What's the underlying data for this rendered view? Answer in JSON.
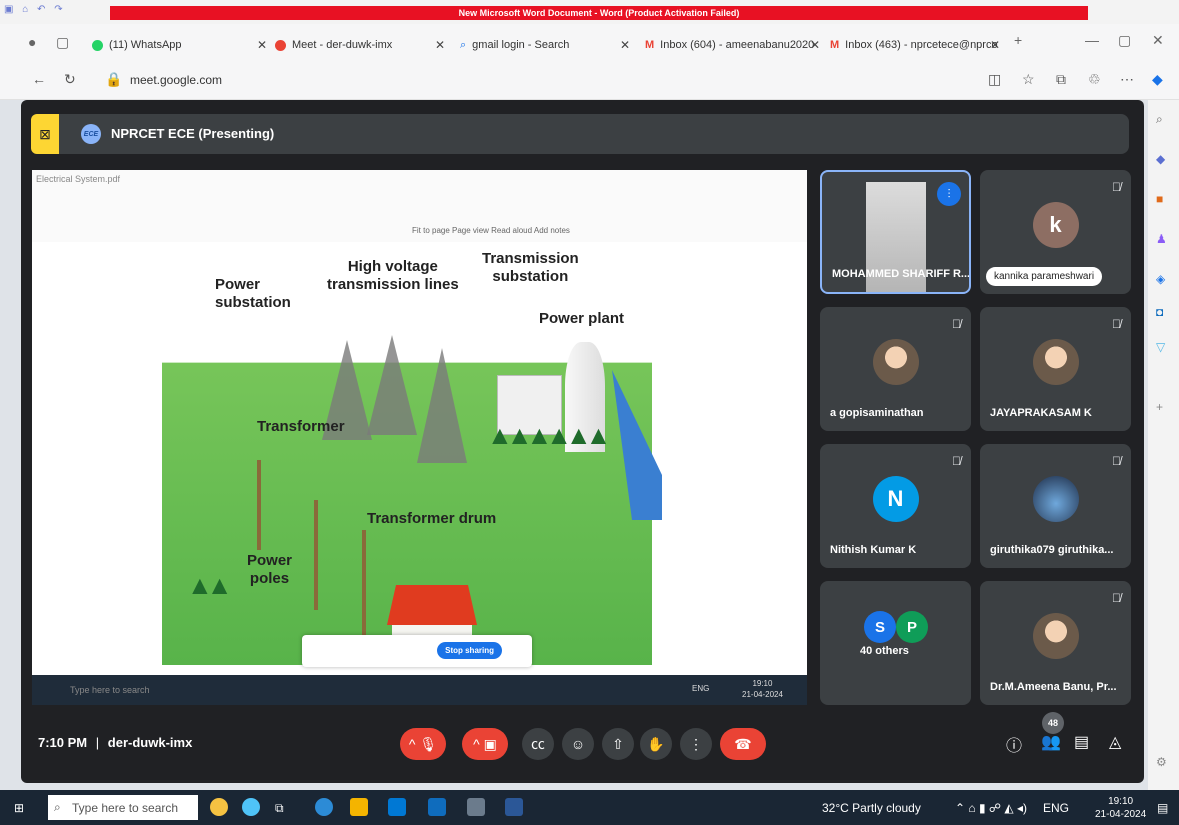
{
  "word": {
    "title": "New Microsoft Word Document - Word (Product Activation Failed)"
  },
  "browser": {
    "tabs": [
      {
        "label": "(11) WhatsApp"
      },
      {
        "label": "Meet - der-duwk-imx"
      },
      {
        "label": "gmail login - Search"
      },
      {
        "label": "Inbox (604) - ameenabanu2020"
      },
      {
        "label": "Inbox (463) - nprcetece@nprco"
      }
    ],
    "url_host": "meet.google.com"
  },
  "meet": {
    "presenter_logo": "ECE",
    "presenter_text": "NPRCET ECE (Presenting)",
    "time": "7:10 PM",
    "separator": "|",
    "code": "der-duwk-imx",
    "people_count": "48",
    "participants": [
      {
        "name": "MOHAMMED SHARIFF R...",
        "speaking": true
      },
      {
        "name": "kannika parameshwari",
        "initial": "k",
        "color": "#8d6e63"
      },
      {
        "name": "a gopisaminathan"
      },
      {
        "name": "JAYAPRAKASAM K"
      },
      {
        "name": "Nithish Kumar K",
        "initial": "N",
        "color": "#039be5"
      },
      {
        "name": "giruthika079 giruthika..."
      },
      {
        "name": "40 others",
        "initials": [
          "S",
          "P"
        ],
        "colors": [
          "#1a73e8",
          "#0f9d58"
        ]
      },
      {
        "name": "Dr.M.Ameena Banu, Pr..."
      }
    ]
  },
  "shared_screen": {
    "window_title": "Electrical System.pdf",
    "toolbar_text": "Fit to page   Page view   Read aloud   Add notes",
    "stop_sharing": "Stop sharing",
    "labels": {
      "power_substation": "Power\nsubstation",
      "high_voltage": "High voltage\ntransmission lines",
      "transmission_substation": "Transmission\nsubstation",
      "power_plant": "Power plant",
      "transformer": "Transformer",
      "transformer_drum": "Transformer drum",
      "power_poles": "Power\npoles"
    },
    "inner_taskbar_search": "Type here to search",
    "inner_clock": "19:10\n21-04-2024",
    "inner_lang": "ENG"
  },
  "taskbar": {
    "search_placeholder": "Type here to search",
    "weather": "32°C  Partly cloudy",
    "lang": "ENG",
    "time": "19:10",
    "date": "21-04-2024"
  }
}
